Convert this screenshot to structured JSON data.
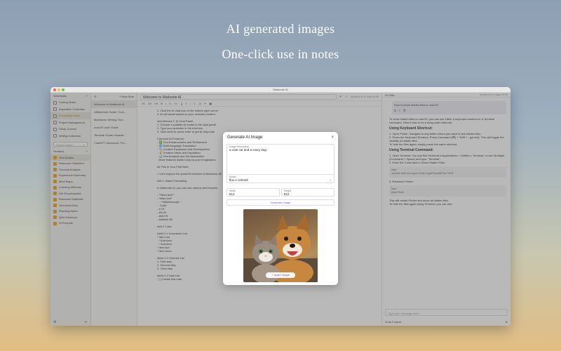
{
  "promo": {
    "line1": "AI generated images",
    "line2": "One-click use in notes"
  },
  "window": {
    "title": "Marknote AI"
  },
  "sidebar": {
    "notebooks_label": "Notebooks",
    "add": "+",
    "notebooks": [
      "Coding Notes",
      "Inspiration Collection",
      "Knowledge Base",
      "Project Management",
      "Study Journal",
      "Writing Collection"
    ],
    "active_index": 2,
    "search_placeholder": "Search notes...",
    "sections_label": "Sections",
    "sections": [
      "Tool Guides",
      "Resource Collection",
      "Concept Analysis",
      "Experience Summary",
      "Mind Maps",
      "Learning Methods",
      "Life Encyclopedia",
      "Research Materials",
      "Technical Docs",
      "Reading Notes",
      "Q&A Solutions",
      "AI Prompts"
    ],
    "active_section": 0
  },
  "notelist": {
    "new_note": "+ New Note",
    "items": [
      "Welcome to Marknote AI",
      "AIMarknote Guide: Com...",
      "Markdown Writing: Surr...",
      "macOS User Guide",
      "Terminal Guide: Essenti...",
      "ChatGPT Advanced: Pro..."
    ]
  },
  "editor": {
    "title": "Welcome to Marknote AI",
    "meta": "Updated at 14 days 09:58",
    "tools": [
      "H1",
      "H2",
      "H3",
      "B",
      "I",
      "S",
      "</>",
      "{}",
      "≡",
      "•",
      "1.",
      "☑",
      "⚭",
      "▣"
    ],
    "lines": [
      "2. Click the AI chat icon in the bottom right corner",
      "3. AI will assist based on your selected content",
      "",
      "### Method 2: AI Chat Panel",
      "1. Choose a suitable AI model in the right panel",
      "2. Type your question in the chat box",
      "3. Click send or press enter to get AI response",
      "",
      "Common AI Features:",
      "- ✅ Text Enhancement and Refinement",
      "- 🌐 Multi-language Translation",
      "- 🔍 Content Expansion and Development",
      "- 💡 Creative Ideas and Inspiration",
      "- 📊 Text Analysis and Summarization",
      "  More features limited only by your imagination",
      "",
      "## This is Your First Note",
      "",
      "> Let's explore the powerful features of Marknote AI!",
      "",
      "### 1. Basic Formatting",
      "",
      "In Marknote AI, you can use various text formats:",
      "",
      "- **Bold text**",
      "- *Italic text*",
      "- ~~Strikethrough~~",
      "- `Code`",
      "- # H1",
      "- ## H2",
      "- ### H3",
      "- ###### H6",
      "",
      "### 2. Lists",
      "",
      "#### 2.1 Unordered List",
      "* Item one",
      "  * Sub-item",
      "  * Sub-item",
      "* Item two",
      "* Item three",
      "",
      "#### 2.2 Ordered List",
      "1. First step",
      "2. Second step",
      "3. Third step",
      "",
      "#### 2.3 Task List",
      "- [ ] Create first note"
    ]
  },
  "chat": {
    "title": "AI Chat",
    "meta": "Updated at 14 days 09:58",
    "user_message": "How to show hidden files in macOS",
    "intro": "To show hidden files in macOS, you can use either a keyboard shortcut or a Terminal command. Here's how to do it using both methods:",
    "h1": "Using Keyboard Shortcut:",
    "k1": "1. Open Finder: Navigate to any folder where you want to see hidden files.",
    "k2": "2. Press the Keyboard Shortcut: Press Command (⌘) + Shift + . (period). This will toggle the visibility of hidden files.",
    "k3": "To hide the files again, simply press the same shortcut.",
    "h2": "Using Terminal Command:",
    "t1": "1. Open Terminal: You can find Terminal in Applications > Utilities > Terminal, or use Spotlight (Command + Space) and type \"Terminal\".",
    "t2": "2. Enter the Command to Show Hidden Files:",
    "code1_lang": "bash",
    "code1": "defaults write com.apple.Finder AppleShowAllFiles TRUE",
    "t3": "3. Relaunch Finder:",
    "code2_lang": "bash",
    "code2": "killall Finder",
    "t4": "This will restart Finder and show all hidden files.",
    "t5": "To hide the files again using Terminal, you can use:",
    "code3_lang": "bash",
    "code3": "defaults write com.apple.Finder AppleShowAllFiles FALSE",
    "input_placeholder": "Type your message here...",
    "model": "Grok-2 latest"
  },
  "modal": {
    "title": "Generate AI Image",
    "close": "×",
    "desc_label": "Image Description",
    "desc_value": "a cute cat and a crazy dog",
    "model_label": "Model",
    "model_value": "flux-1-schnell",
    "width_label": "Width",
    "width_value": "512",
    "height_label": "Height",
    "height_value": "512",
    "generate_label": "Generate Image",
    "insert_label": "+ Insert Image"
  },
  "colors": {
    "accent": "#7a55d6",
    "section": "#e0a336",
    "active_notebook": "#b88a2a"
  }
}
